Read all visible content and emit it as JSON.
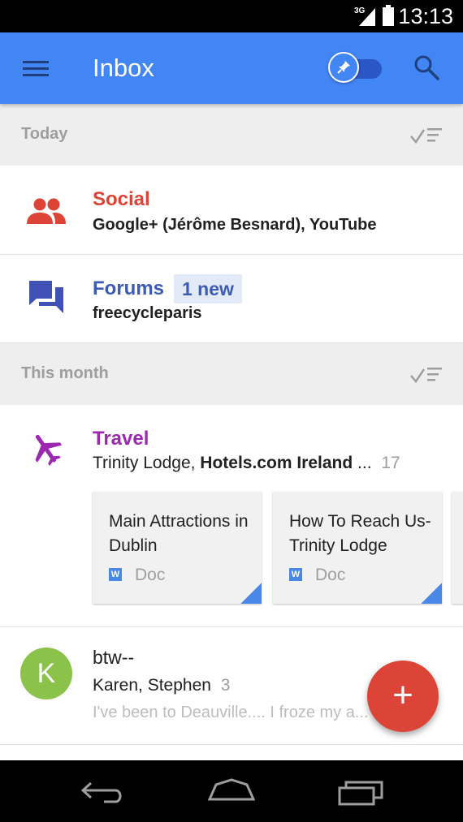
{
  "status_bar": {
    "network": "3G",
    "time": "13:13"
  },
  "app_bar": {
    "title": "Inbox",
    "menu_icon": "hamburger-menu-icon",
    "pin_icon": "pin-icon",
    "search_icon": "search-icon",
    "accent": "#4285f4"
  },
  "sections": [
    {
      "label": "Today",
      "items": [
        {
          "title": "Social",
          "subtitle": "Google+ (Jérôme Besnard), YouTube",
          "icon": "people-icon",
          "color": "#db4437"
        },
        {
          "title": "Forums",
          "badge": "1 new",
          "subtitle": "freecycleparis",
          "icon": "forum-icon",
          "color": "#3f51b5"
        }
      ]
    },
    {
      "label": "This month",
      "items": [
        {
          "title": "Travel",
          "icon": "airplane-icon",
          "color": "#9c27b0",
          "senders_plain": "Trinity Lodge, ",
          "senders_bold": "Hotels.com Ireland",
          "ellipsis": " ...",
          "count": "17",
          "attachments": [
            {
              "title": "Main Attractions in Dublin",
              "type": "Doc",
              "file_icon": "W"
            },
            {
              "title": "How To Reach Us-Trinity Lodge",
              "type": "Doc",
              "file_icon": "W"
            }
          ]
        }
      ]
    }
  ],
  "conversation": {
    "avatar_letter": "K",
    "avatar_color": "#8bc34a",
    "subject": "btw--",
    "participants": "Karen, Stephen",
    "count": "3",
    "snippet": "I've been to Deauville.... I froze my a... ."
  },
  "fab": {
    "label": "+",
    "color": "#db4437"
  },
  "nav": {
    "back_icon": "back-icon",
    "home_icon": "home-icon",
    "recents_icon": "recents-icon"
  }
}
